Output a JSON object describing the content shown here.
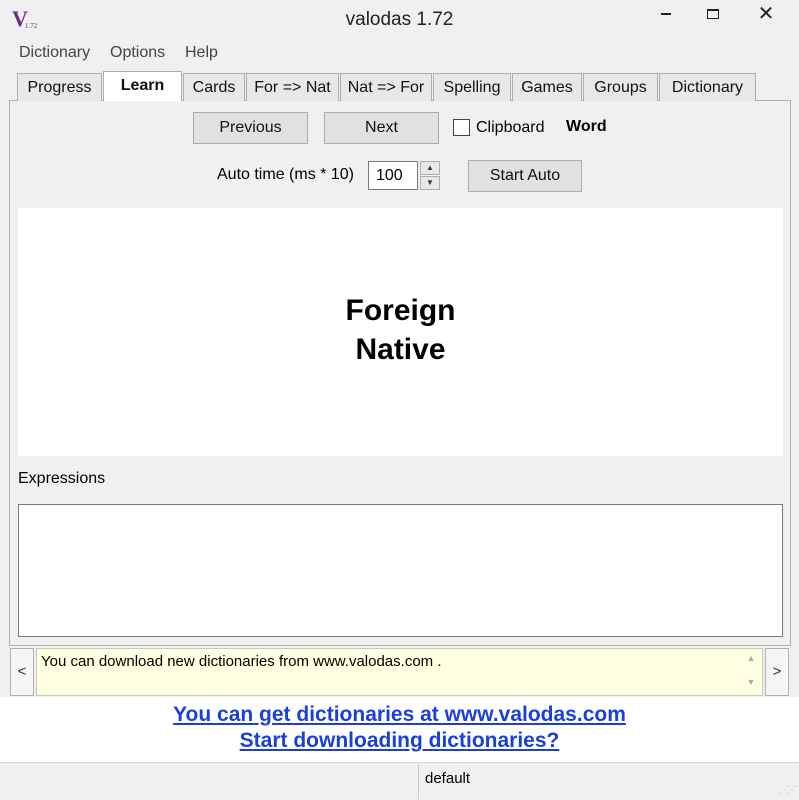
{
  "window": {
    "title": "valodas 1.72",
    "icon_letter": "V",
    "icon_sub": "1.72"
  },
  "menu": [
    "Dictionary",
    "Options",
    "Help"
  ],
  "tabs": [
    {
      "label": "Progress",
      "active": false
    },
    {
      "label": "Learn",
      "active": true
    },
    {
      "label": "Cards",
      "active": false
    },
    {
      "label": "For => Nat",
      "active": false
    },
    {
      "label": "Nat => For",
      "active": false
    },
    {
      "label": "Spelling",
      "active": false
    },
    {
      "label": "Games",
      "active": false
    },
    {
      "label": "Groups",
      "active": false
    },
    {
      "label": "Dictionary",
      "active": false
    }
  ],
  "learn": {
    "previous_label": "Previous",
    "next_label": "Next",
    "clipboard_label": "Clipboard",
    "clipboard_checked": false,
    "word_label": "Word",
    "auto_time_label": "Auto time (ms * 10)",
    "auto_time_value": "100",
    "start_auto_label": "Start Auto",
    "foreign": "Foreign",
    "native": "Native",
    "expressions_label": "Expressions"
  },
  "info": {
    "message": "You can download new dictionaries from www.valodas.com .",
    "prev_symbol": "<",
    "next_symbol": ">"
  },
  "links": {
    "get_dictionaries": "You can get dictionaries at www.valodas.com",
    "start_downloading": "Start downloading dictionaries?"
  },
  "status": {
    "profile": "default"
  }
}
